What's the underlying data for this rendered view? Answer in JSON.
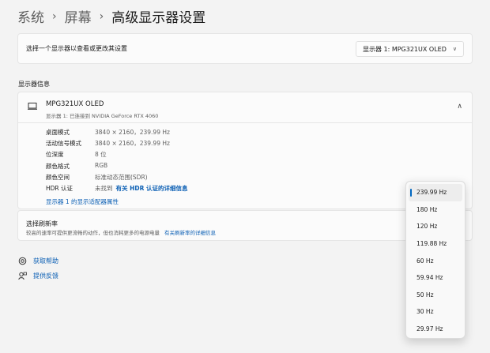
{
  "breadcrumb": {
    "system": "系统",
    "screen": "屏幕",
    "current": "高级显示器设置",
    "sep": "›"
  },
  "select_display": {
    "label": "选择一个显示器以查看或更改其设置",
    "value": "显示器 1: MPG321UX OLED"
  },
  "display_info": {
    "section_title": "显示器信息",
    "name": "MPG321UX OLED",
    "subtitle": "显示器 1: 已连接到 NVIDIA GeForce RTX 4060",
    "rows": [
      {
        "key": "桌面模式",
        "value": "3840 × 2160，239.99 Hz"
      },
      {
        "key": "活动信号模式",
        "value": "3840 × 2160，239.99 Hz"
      },
      {
        "key": "位深度",
        "value": "8 位"
      },
      {
        "key": "颜色格式",
        "value": "RGB"
      },
      {
        "key": "颜色空间",
        "value": "标准动态范围(SDR)"
      },
      {
        "key": "HDR 认证",
        "value": "未找到",
        "link": "有关 HDR 认证的详细信息"
      }
    ],
    "adapter_link": "显示器 1 的显示适配器属性"
  },
  "refresh": {
    "title": "选择刷新率",
    "desc": "较高的速率可提供更流畅的动作，但也消耗更多的电源电量",
    "link": "有关刷新率的详细信息"
  },
  "help": {
    "get_help": "获取帮助",
    "feedback": "提供反馈"
  },
  "refresh_menu": {
    "selected_index": 0,
    "options": [
      "239.99 Hz",
      "180 Hz",
      "120 Hz",
      "119.88 Hz",
      "60 Hz",
      "59.94 Hz",
      "50 Hz",
      "30 Hz",
      "29.97 Hz"
    ]
  },
  "colors": {
    "accent": "#0067c0",
    "link": "#0b5fb4"
  }
}
